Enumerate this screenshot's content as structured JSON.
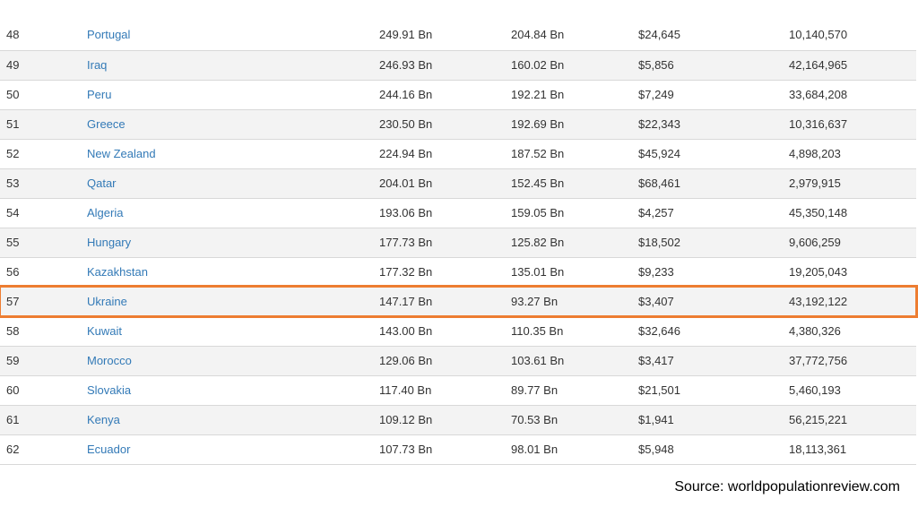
{
  "table": {
    "rows": [
      {
        "rank": "48",
        "country": "Portugal",
        "gdp": "249.91 Bn",
        "nominal": "204.84 Bn",
        "per_capita": "$24,645",
        "population": "10,140,570"
      },
      {
        "rank": "49",
        "country": "Iraq",
        "gdp": "246.93 Bn",
        "nominal": "160.02 Bn",
        "per_capita": "$5,856",
        "population": "42,164,965"
      },
      {
        "rank": "50",
        "country": "Peru",
        "gdp": "244.16 Bn",
        "nominal": "192.21 Bn",
        "per_capita": "$7,249",
        "population": "33,684,208"
      },
      {
        "rank": "51",
        "country": "Greece",
        "gdp": "230.50 Bn",
        "nominal": "192.69 Bn",
        "per_capita": "$22,343",
        "population": "10,316,637"
      },
      {
        "rank": "52",
        "country": "New Zealand",
        "gdp": "224.94 Bn",
        "nominal": "187.52 Bn",
        "per_capita": "$45,924",
        "population": "4,898,203"
      },
      {
        "rank": "53",
        "country": "Qatar",
        "gdp": "204.01 Bn",
        "nominal": "152.45 Bn",
        "per_capita": "$68,461",
        "population": "2,979,915"
      },
      {
        "rank": "54",
        "country": "Algeria",
        "gdp": "193.06 Bn",
        "nominal": "159.05 Bn",
        "per_capita": "$4,257",
        "population": "45,350,148"
      },
      {
        "rank": "55",
        "country": "Hungary",
        "gdp": "177.73 Bn",
        "nominal": "125.82 Bn",
        "per_capita": "$18,502",
        "population": "9,606,259"
      },
      {
        "rank": "56",
        "country": "Kazakhstan",
        "gdp": "177.32 Bn",
        "nominal": "135.01 Bn",
        "per_capita": "$9,233",
        "population": "19,205,043"
      },
      {
        "rank": "57",
        "country": "Ukraine",
        "gdp": "147.17 Bn",
        "nominal": "93.27 Bn",
        "per_capita": "$3,407",
        "population": "43,192,122"
      },
      {
        "rank": "58",
        "country": "Kuwait",
        "gdp": "143.00 Bn",
        "nominal": "110.35 Bn",
        "per_capita": "$32,646",
        "population": "4,380,326"
      },
      {
        "rank": "59",
        "country": "Morocco",
        "gdp": "129.06 Bn",
        "nominal": "103.61 Bn",
        "per_capita": "$3,417",
        "population": "37,772,756"
      },
      {
        "rank": "60",
        "country": "Slovakia",
        "gdp": "117.40 Bn",
        "nominal": "89.77 Bn",
        "per_capita": "$21,501",
        "population": "5,460,193"
      },
      {
        "rank": "61",
        "country": "Kenya",
        "gdp": "109.12 Bn",
        "nominal": "70.53 Bn",
        "per_capita": "$1,941",
        "population": "56,215,221"
      },
      {
        "rank": "62",
        "country": "Ecuador",
        "gdp": "107.73 Bn",
        "nominal": "98.01 Bn",
        "per_capita": "$5,948",
        "population": "18,113,361"
      }
    ],
    "highlighted_rank": "57"
  },
  "colors": {
    "link": "#337ab7",
    "highlight_border": "#ed7d31",
    "stripe": "#f3f3f3"
  },
  "source": "Source: worldpopulationreview.com"
}
